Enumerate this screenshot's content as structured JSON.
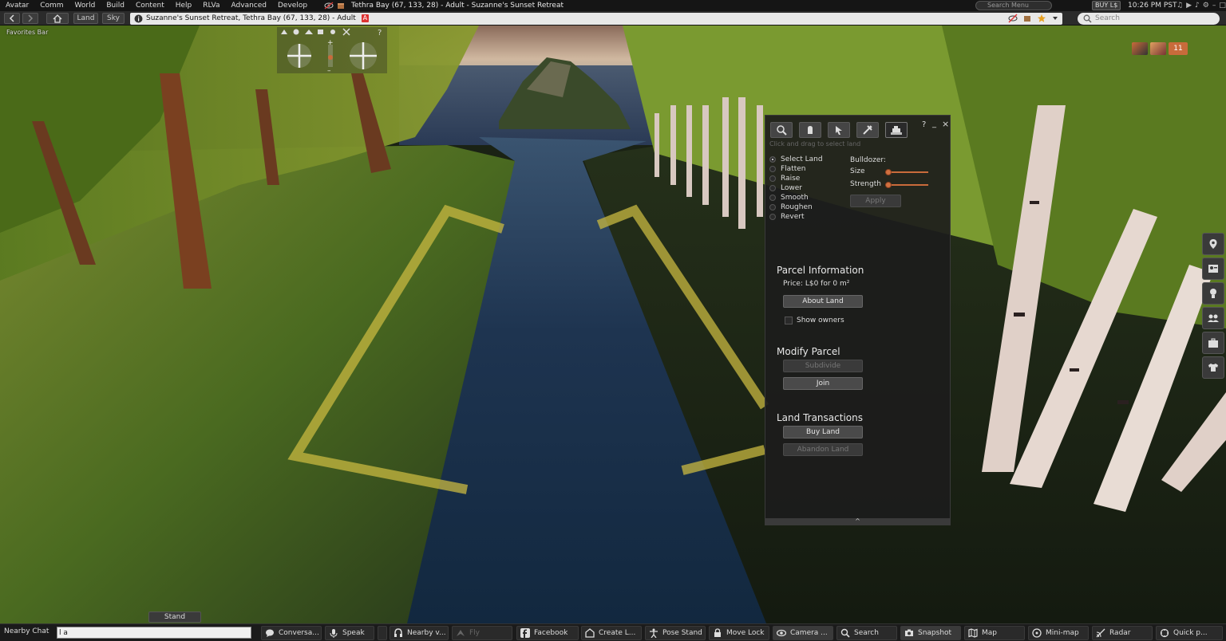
{
  "menu": {
    "items": [
      "Avatar",
      "Comm",
      "World",
      "Build",
      "Content",
      "Help",
      "RLVa",
      "Advanced",
      "Develop"
    ],
    "region_title": "Tethra Bay (67, 133, 28) - Adult - Suzanne's Sunset Retreat",
    "search_placeholder": "Search Menu",
    "buy_label": "BUY L$",
    "clock": "10:26 PM PST"
  },
  "nav": {
    "land_label": "Land",
    "sky_label": "Sky",
    "location_text": "Suzanne's Sunset Retreat, Tethra Bay (67, 133, 28) - Adult",
    "maturity_badge": "A",
    "search_placeholder": "Search",
    "favorites_label": "Favorites Bar"
  },
  "notifications": {
    "count": "11"
  },
  "land_tool": {
    "hint": "Click and drag to select land",
    "tools": [
      "zoom-icon",
      "move-icon",
      "edit-icon",
      "create-icon",
      "land-icon"
    ],
    "options": [
      {
        "label": "Select Land",
        "selected": true
      },
      {
        "label": "Flatten",
        "selected": false
      },
      {
        "label": "Raise",
        "selected": false
      },
      {
        "label": "Lower",
        "selected": false
      },
      {
        "label": "Smooth",
        "selected": false
      },
      {
        "label": "Roughen",
        "selected": false
      },
      {
        "label": "Revert",
        "selected": false
      }
    ],
    "bulldozer_label": "Bulldozer:",
    "size_label": "Size",
    "strength_label": "Strength",
    "apply_label": "Apply",
    "parcel_info_title": "Parcel Information",
    "price_text": "Price: L$0 for 0 m²",
    "about_land_label": "About Land",
    "show_owners_label": "Show owners",
    "modify_parcel_title": "Modify Parcel",
    "subdivide_label": "Subdivide",
    "join_label": "Join",
    "land_transactions_title": "Land Transactions",
    "buy_land_label": "Buy Land",
    "abandon_land_label": "Abandon Land",
    "help_glyph": "?",
    "minimize_glyph": "_",
    "close_glyph": "×",
    "expand_glyph": "^"
  },
  "stand_label": "Stand",
  "bottom": {
    "nearby_chat_label": "Nearby Chat",
    "chat_value": "l a",
    "buttons": {
      "conversations": "Conversa...",
      "speak": "Speak",
      "nearby_voice": "Nearby v...",
      "fly": "Fly",
      "facebook": "Facebook",
      "create": "Create L...",
      "pose_stand": "Pose Stand",
      "move_lock": "Move Lock",
      "camera": "Camera ...",
      "search": "Search",
      "snapshot": "Snapshot",
      "map": "Map",
      "minimap": "Mini-map",
      "radar": "Radar",
      "quick": "Quick p..."
    }
  },
  "colors": {
    "accent": "#c96b3b",
    "panel": "#1c1c1c",
    "parcel_line": "#c8b840"
  }
}
